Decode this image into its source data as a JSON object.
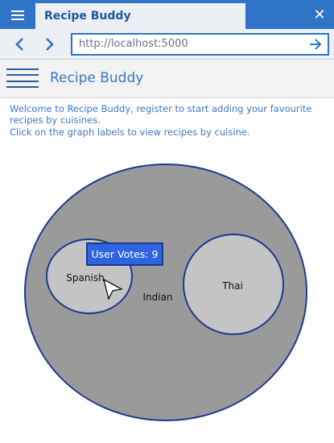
{
  "browser": {
    "tab_title": "Recipe Buddy",
    "url": "http://localhost:5000",
    "close_glyph": "✕"
  },
  "app": {
    "title": "Recipe Buddy"
  },
  "intro": {
    "line1": "Welcome to Recipe Buddy, register to start adding your favourite recipes by cuisines.",
    "line2": "Click on the graph labels to view recipes by cuisine."
  },
  "chart_data": {
    "type": "bubble",
    "nodes": [
      {
        "label": "Indian",
        "role": "container",
        "color": "#9a9a9a"
      },
      {
        "label": "Spanish",
        "role": "child",
        "color": "#c4c4c4"
      },
      {
        "label": "Thai",
        "role": "child",
        "color": "#c4c4c4"
      }
    ],
    "tooltip": "User Votes: 9",
    "colors": {
      "stroke": "#1d3a8c",
      "tooltip_bg": "#2f64e0"
    }
  }
}
